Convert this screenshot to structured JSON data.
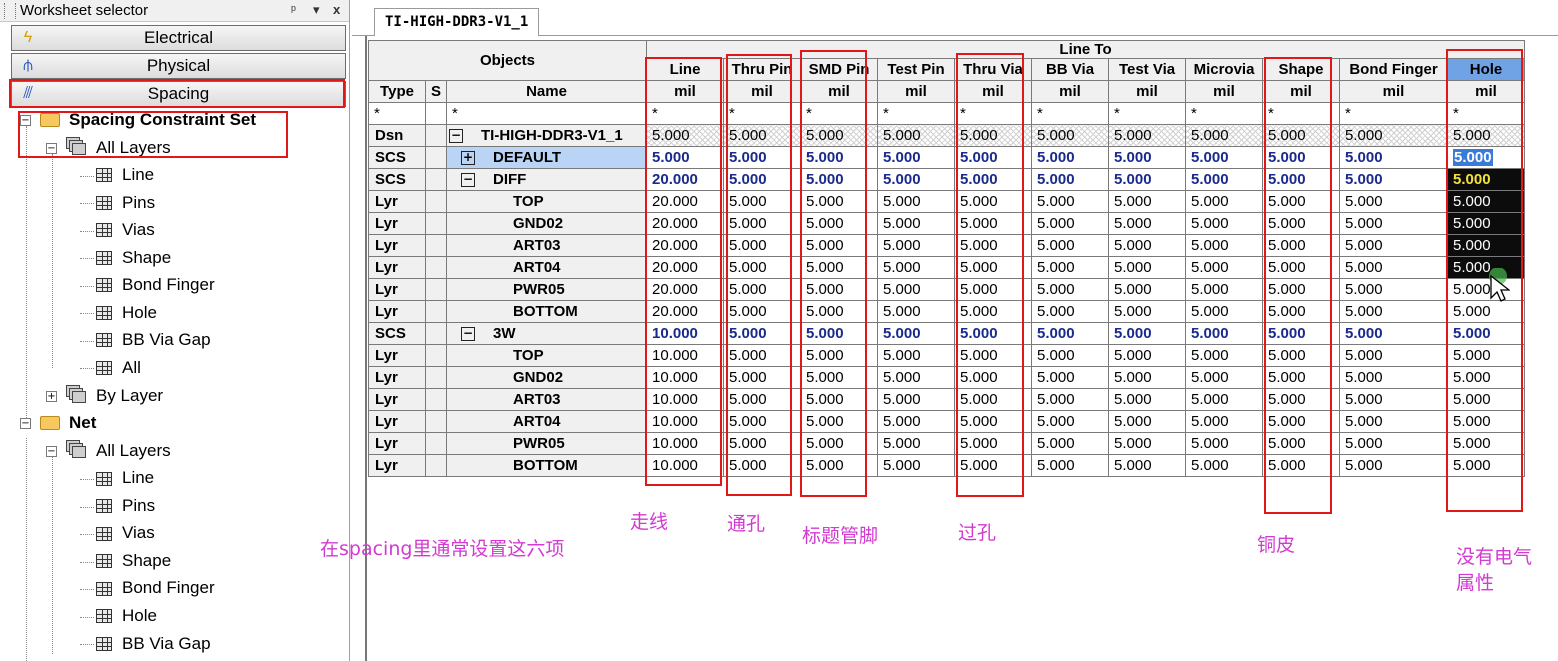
{
  "panel": {
    "title": "Worksheet selector",
    "pin_icon": "pin-icon",
    "close_label": "x",
    "dropdown_label": "▾"
  },
  "worksheet_buttons": [
    {
      "label": "Electrical",
      "icon": "lightning-icon"
    },
    {
      "label": "Physical",
      "icon": "physical-icon"
    },
    {
      "label": "Spacing",
      "icon": "spacing-icon",
      "selected": true
    }
  ],
  "tree": {
    "spacing_set": "Spacing Constraint Set",
    "all_layers": "All Layers",
    "items1": [
      "Line",
      "Pins",
      "Vias",
      "Shape",
      "Bond Finger",
      "Hole",
      "BB Via Gap",
      "All"
    ],
    "by_layer": "By Layer",
    "net": "Net",
    "net_all_layers": "All Layers",
    "items2": [
      "Line",
      "Pins",
      "Vias",
      "Shape",
      "Bond Finger",
      "Hole",
      "BB Via Gap"
    ]
  },
  "tab": {
    "label": "TI-HIGH-DDR3-V1_1"
  },
  "grid": {
    "objects_header": "Objects",
    "line_to_header": "Line To",
    "type_header": "Type",
    "s_header": "S",
    "name_header": "Name",
    "star": "*",
    "columns": [
      "Line",
      "Thru Pin",
      "SMD Pin",
      "Test Pin",
      "Thru Via",
      "BB Via",
      "Test Via",
      "Microvia",
      "Shape",
      "Bond Finger",
      "Hole"
    ],
    "unit": "mil",
    "rows": [
      {
        "type": "Dsn",
        "name": "TI-HIGH-DDR3-V1_1",
        "expander": "−",
        "values": [
          "5.000",
          "5.000",
          "5.000",
          "5.000",
          "5.000",
          "5.000",
          "5.000",
          "5.000",
          "5.000",
          "5.000",
          "5.000"
        ]
      },
      {
        "type": "SCS",
        "name": "DEFAULT",
        "expander": "+",
        "values": [
          "5.000",
          "5.000",
          "5.000",
          "5.000",
          "5.000",
          "5.000",
          "5.000",
          "5.000",
          "5.000",
          "5.000",
          "5.000"
        ]
      },
      {
        "type": "SCS",
        "name": "DIFF",
        "expander": "−",
        "values": [
          "20.000",
          "5.000",
          "5.000",
          "5.000",
          "5.000",
          "5.000",
          "5.000",
          "5.000",
          "5.000",
          "5.000",
          "5.000"
        ]
      },
      {
        "type": "Lyr",
        "name": "TOP",
        "values": [
          "20.000",
          "5.000",
          "5.000",
          "5.000",
          "5.000",
          "5.000",
          "5.000",
          "5.000",
          "5.000",
          "5.000",
          "5.000"
        ]
      },
      {
        "type": "Lyr",
        "name": "GND02",
        "values": [
          "20.000",
          "5.000",
          "5.000",
          "5.000",
          "5.000",
          "5.000",
          "5.000",
          "5.000",
          "5.000",
          "5.000",
          "5.000"
        ]
      },
      {
        "type": "Lyr",
        "name": "ART03",
        "values": [
          "20.000",
          "5.000",
          "5.000",
          "5.000",
          "5.000",
          "5.000",
          "5.000",
          "5.000",
          "5.000",
          "5.000",
          "5.000"
        ]
      },
      {
        "type": "Lyr",
        "name": "ART04",
        "values": [
          "20.000",
          "5.000",
          "5.000",
          "5.000",
          "5.000",
          "5.000",
          "5.000",
          "5.000",
          "5.000",
          "5.000",
          "5.000"
        ]
      },
      {
        "type": "Lyr",
        "name": "PWR05",
        "values": [
          "20.000",
          "5.000",
          "5.000",
          "5.000",
          "5.000",
          "5.000",
          "5.000",
          "5.000",
          "5.000",
          "5.000",
          "5.000"
        ]
      },
      {
        "type": "Lyr",
        "name": "BOTTOM",
        "values": [
          "20.000",
          "5.000",
          "5.000",
          "5.000",
          "5.000",
          "5.000",
          "5.000",
          "5.000",
          "5.000",
          "5.000",
          "5.000"
        ]
      },
      {
        "type": "SCS",
        "name": "3W",
        "expander": "−",
        "values": [
          "10.000",
          "5.000",
          "5.000",
          "5.000",
          "5.000",
          "5.000",
          "5.000",
          "5.000",
          "5.000",
          "5.000",
          "5.000"
        ]
      },
      {
        "type": "Lyr",
        "name": "TOP",
        "values": [
          "10.000",
          "5.000",
          "5.000",
          "5.000",
          "5.000",
          "5.000",
          "5.000",
          "5.000",
          "5.000",
          "5.000",
          "5.000"
        ]
      },
      {
        "type": "Lyr",
        "name": "GND02",
        "values": [
          "10.000",
          "5.000",
          "5.000",
          "5.000",
          "5.000",
          "5.000",
          "5.000",
          "5.000",
          "5.000",
          "5.000",
          "5.000"
        ]
      },
      {
        "type": "Lyr",
        "name": "ART03",
        "values": [
          "10.000",
          "5.000",
          "5.000",
          "5.000",
          "5.000",
          "5.000",
          "5.000",
          "5.000",
          "5.000",
          "5.000",
          "5.000"
        ]
      },
      {
        "type": "Lyr",
        "name": "ART04",
        "values": [
          "10.000",
          "5.000",
          "5.000",
          "5.000",
          "5.000",
          "5.000",
          "5.000",
          "5.000",
          "5.000",
          "5.000",
          "5.000"
        ]
      },
      {
        "type": "Lyr",
        "name": "PWR05",
        "values": [
          "10.000",
          "5.000",
          "5.000",
          "5.000",
          "5.000",
          "5.000",
          "5.000",
          "5.000",
          "5.000",
          "5.000",
          "5.000"
        ]
      },
      {
        "type": "Lyr",
        "name": "BOTTOM",
        "values": [
          "10.000",
          "5.000",
          "5.000",
          "5.000",
          "5.000",
          "5.000",
          "5.000",
          "5.000",
          "5.000",
          "5.000",
          "5.000"
        ]
      }
    ]
  },
  "annotations": {
    "main": "在spacing里通常设置这六项",
    "line": "走线",
    "thru_pin": "通孔",
    "smd_pin": "标题管脚",
    "thru_via": "过孔",
    "shape": "铜皮",
    "hole_1": "没有电气",
    "hole_2": "属性"
  },
  "colors": {
    "annotation": "#d23ad1",
    "highlight_box": "#e01818",
    "scs_value": "#1a2a8c",
    "hole_header": "#6fa3e6",
    "selection": "#3a7bd8"
  }
}
